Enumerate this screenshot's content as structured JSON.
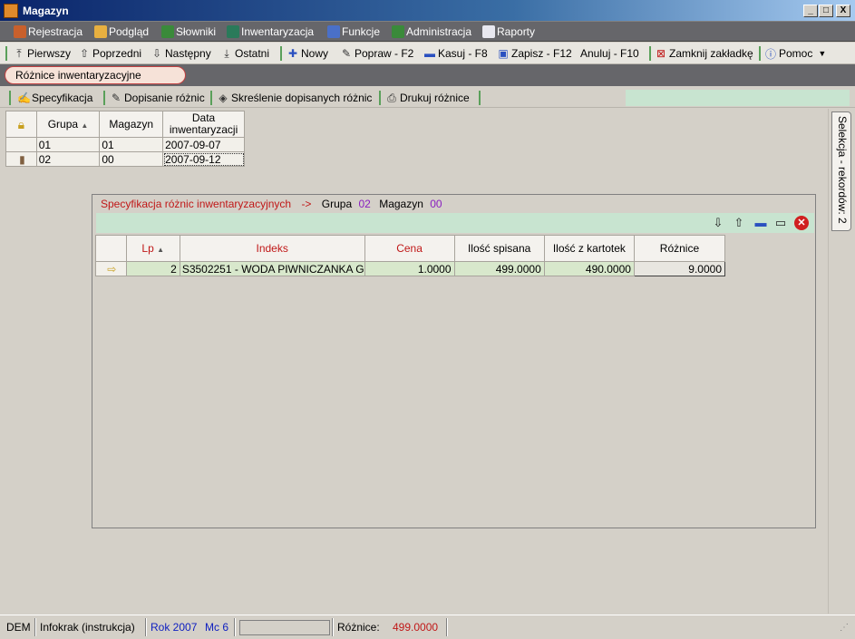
{
  "window": {
    "title": "Magazyn",
    "controls": [
      "_",
      "□",
      "X"
    ]
  },
  "menu": [
    {
      "label": "Rejestracja",
      "icon": "registration-icon"
    },
    {
      "label": "Podgląd",
      "icon": "preview-icon"
    },
    {
      "label": "Słowniki",
      "icon": "dictionaries-icon"
    },
    {
      "label": "Inwentaryzacja",
      "icon": "inventory-icon"
    },
    {
      "label": "Funkcje",
      "icon": "functions-icon"
    },
    {
      "label": "Administracja",
      "icon": "administration-icon"
    },
    {
      "label": "Raporty",
      "icon": "reports-icon"
    }
  ],
  "toolbar": {
    "first": "Pierwszy",
    "prev": "Poprzedni",
    "next": "Następny",
    "last": "Ostatni",
    "new": "Nowy",
    "edit": "Popraw - F2",
    "delete": "Kasuj - F8",
    "save": "Zapisz - F12",
    "cancel": "Anuluj - F10",
    "close_tab": "Zamknij zakładkę",
    "help": "Pomoc"
  },
  "tab": {
    "label": "Różnice inwentaryzacyjne"
  },
  "subtoolbar": {
    "spec": "Specyfikacja",
    "add_diff": "Dopisanie różnic",
    "strike": "Skreślenie dopisanych różnic",
    "print": "Drukuj różnice"
  },
  "master_grid": {
    "columns": [
      "Grupa",
      "Magazyn",
      "Data\ninwentaryzacji"
    ],
    "rows": [
      {
        "grupa": "01",
        "magazyn": "01",
        "data": "2007-09-07"
      },
      {
        "grupa": "02",
        "magazyn": "00",
        "data": "2007-09-12"
      }
    ]
  },
  "side_tab": "Selekcja - rekordów: 2",
  "subwindow": {
    "title_prefix": "Specyfikacja różnic inwentaryzacyjnych",
    "arrow": "->",
    "grupa_label": "Grupa",
    "grupa_value": "02",
    "magazyn_label": "Magazyn",
    "magazyn_value": "00",
    "columns": [
      "Lp",
      "Indeks",
      "Cena",
      "Ilość spisana",
      "Ilość z kartotek",
      "Różnice"
    ],
    "rows": [
      {
        "lp": "2",
        "indeks": "S3502251 - WODA PIWNICZANKA G",
        "cena": "1.0000",
        "spisana": "499.0000",
        "kartotek": "490.0000",
        "roznice": "9.0000"
      }
    ]
  },
  "status": {
    "user": "DEM",
    "company": "Infokrak (instrukcja)",
    "year": "Rok 2007",
    "month": "Mc 6",
    "diff_label": "Różnice:",
    "diff_value": "499.0000"
  },
  "colors": {
    "accent_red": "#c01818",
    "value_purple": "#8a20c0",
    "status_blue": "#1020c0"
  }
}
